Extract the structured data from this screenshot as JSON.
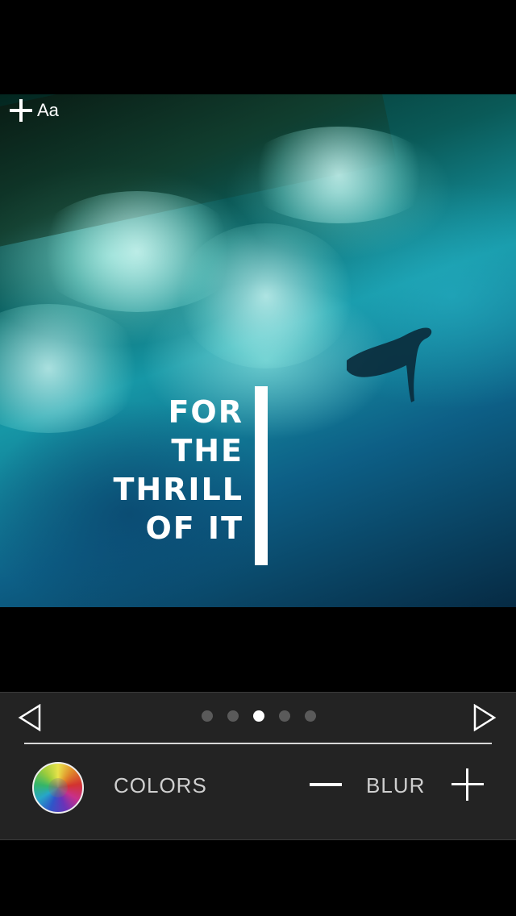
{
  "canvas": {
    "add_text_label": "Aa",
    "quote_lines": [
      "FOR",
      "THE",
      "THRILL",
      "OF IT"
    ]
  },
  "controls": {
    "pager": {
      "total": 5,
      "active_index": 2
    },
    "colors_label": "COLORS",
    "blur_label": "BLUR"
  },
  "icons": {
    "add_text": "plus-icon",
    "prev": "triangle-left-icon",
    "next": "triangle-right-icon",
    "color_wheel": "color-wheel-icon",
    "blur_decrease": "minus-icon",
    "blur_increase": "plus-icon"
  },
  "colors": {
    "background": "#000000",
    "panel": "#232323",
    "panel_text": "#cfcfcf",
    "quote_text": "#ffffff"
  }
}
